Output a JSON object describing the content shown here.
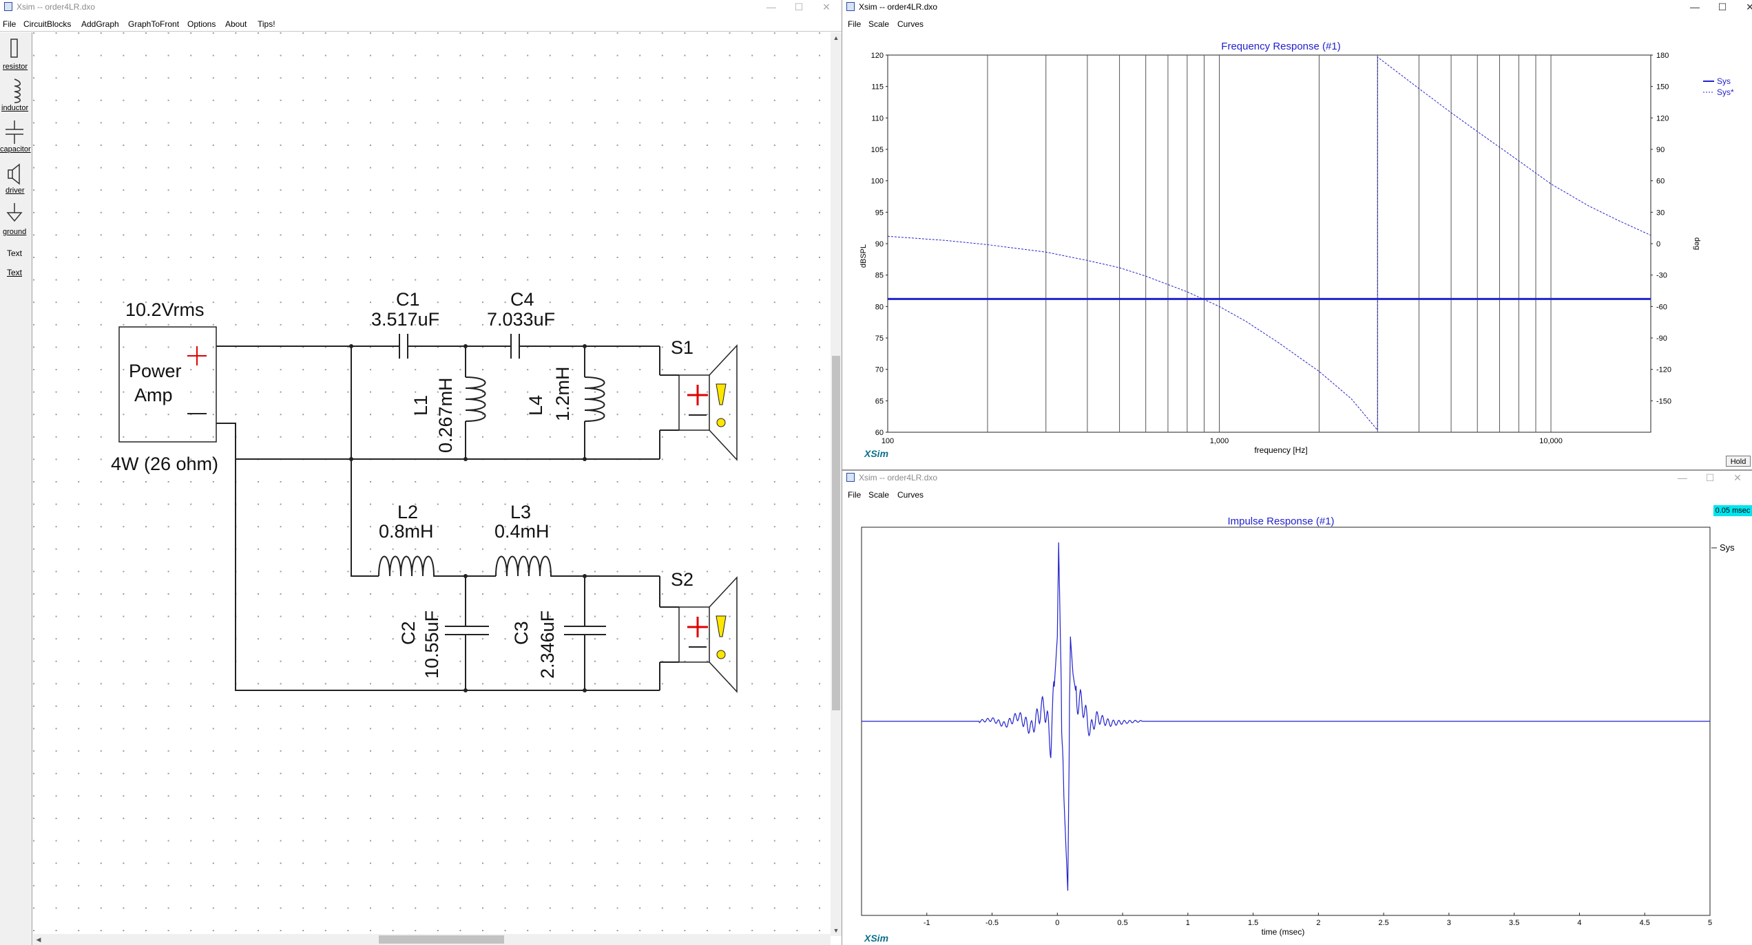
{
  "schematic_window": {
    "title": "Xsim -- order4LR.dxo",
    "menu": [
      "File",
      "CircuitBlocks",
      "AddGraph",
      "GraphToFront",
      "Options",
      "About",
      "Tips!"
    ],
    "palette": [
      {
        "name": "resistor-icon",
        "label": "resistor"
      },
      {
        "name": "inductor-icon",
        "label": "inductor"
      },
      {
        "name": "capacitor-icon",
        "label": "capacitor"
      },
      {
        "name": "driver-icon",
        "label": "driver"
      },
      {
        "name": "ground-icon",
        "label": "ground"
      },
      {
        "name": "text-tool",
        "label": "Text"
      },
      {
        "name": "text-link-tool",
        "label": "Text"
      }
    ],
    "circuit": {
      "amp_voltage": "10.2Vrms",
      "amp_line1": "Power",
      "amp_line2": "Amp",
      "amp_load": "4W (26 ohm)",
      "c1_name": "C1",
      "c1_value": "3.517uF",
      "c4_name": "C4",
      "c4_value": "7.033uF",
      "l1_name": "L1",
      "l1_value": "0.267mH",
      "l4_name": "L4",
      "l4_value": "1.2mH",
      "s1_name": "S1",
      "l2_name": "L2",
      "l2_value": "0.8mH",
      "l3_name": "L3",
      "l3_value": "0.4mH",
      "c2_name": "C2",
      "c2_value": "10.55uF",
      "c3_name": "C3",
      "c3_value": "2.346uF",
      "s2_name": "S2"
    }
  },
  "freq_window": {
    "title": "Xsim -- order4LR.dxo",
    "menu": [
      "File",
      "Scale",
      "Curves"
    ],
    "hold_label": "Hold",
    "brand": "XSim",
    "chart_data": {
      "type": "line",
      "title": "Frequency Response (#1)",
      "xlabel": "frequency [Hz]",
      "ylabel": "dBSPL",
      "y2label": "deg",
      "x_scale": "log",
      "xlim": [
        100,
        20000
      ],
      "ylim": [
        60,
        120
      ],
      "y2lim": [
        -180,
        180
      ],
      "x_tick_labels": [
        "100",
        "1,000",
        "10,000"
      ],
      "x_ticks": [
        100,
        1000,
        10000
      ],
      "y_ticks": [
        60,
        65,
        70,
        75,
        80,
        85,
        90,
        95,
        100,
        105,
        110,
        115,
        120
      ],
      "y2_ticks": [
        -150,
        -120,
        -90,
        -60,
        -30,
        0,
        30,
        60,
        90,
        120,
        150,
        180
      ],
      "grid": true,
      "legend_position": "top-right",
      "series": [
        {
          "name": "Sys",
          "axis": "left",
          "style": "solid",
          "x": [
            100,
            20000
          ],
          "values": [
            81.2,
            81.2
          ]
        },
        {
          "name": "Sys*",
          "axis": "right",
          "style": "dotted",
          "x": [
            100,
            150,
            200,
            300,
            400,
            500,
            600,
            700,
            800,
            1000,
            1200,
            1500,
            2000,
            2500,
            3000,
            3001,
            3500,
            4000,
            5000,
            6000,
            8000,
            10000,
            13000,
            16000,
            20000
          ],
          "values": [
            7,
            3,
            -1,
            -8,
            -16,
            -23,
            -31,
            -39,
            -46,
            -60,
            -74,
            -94,
            -122,
            -148,
            -178,
            178,
            162,
            148,
            125,
            107,
            79,
            57,
            36,
            22,
            8
          ]
        }
      ]
    }
  },
  "impulse_window": {
    "title": "Xsim -- order4LR.dxo",
    "menu": [
      "File",
      "Scale",
      "Curves"
    ],
    "badge": "0.05 msec",
    "brand": "XSim",
    "chart_data": {
      "type": "line",
      "title": "Impulse Response (#1)",
      "xlabel": "time (msec)",
      "xlim": [
        -1.5,
        5
      ],
      "ylim": [
        -1,
        1
      ],
      "x_tick_labels": [
        "-1",
        "-0.5",
        "0",
        "0.5",
        "1",
        "1.5",
        "2",
        "2.5",
        "3",
        "3.5",
        "4",
        "4.5",
        "5"
      ],
      "x_ticks": [
        -1,
        -0.5,
        0,
        0.5,
        1,
        1.5,
        2,
        2.5,
        3,
        3.5,
        4,
        4.5,
        5
      ],
      "grid": false,
      "legend_position": "top-right",
      "series": [
        {
          "name": "Sys",
          "x": [
            -1.5,
            -0.6,
            -0.5,
            -0.4,
            -0.3,
            -0.2,
            -0.1,
            -0.05,
            0.0,
            0.01,
            0.03,
            0.05,
            0.08,
            0.1,
            0.12,
            0.15,
            0.2,
            0.25,
            0.3,
            0.4,
            0.6,
            5
          ],
          "values": [
            0,
            0,
            0.01,
            -0.02,
            0.03,
            -0.04,
            0.09,
            -0.12,
            0.45,
            0.95,
            0.2,
            -0.4,
            -0.9,
            0.45,
            0.25,
            0.12,
            0.08,
            -0.05,
            0.02,
            -0.01,
            0,
            0
          ]
        }
      ]
    }
  }
}
